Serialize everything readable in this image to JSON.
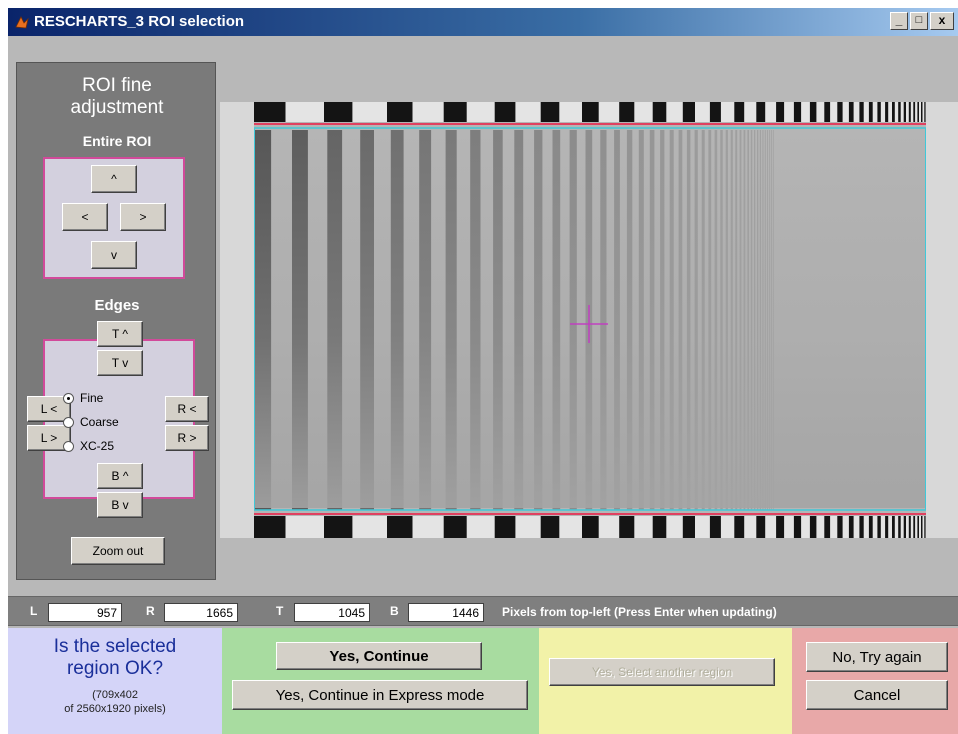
{
  "window": {
    "title": "RESCHARTS_3 ROI selection",
    "controls": [
      "_",
      "□",
      "x"
    ]
  },
  "roi_panel": {
    "title_line1": "ROI fine",
    "title_line2": "adjustment",
    "entire_roi_label": "Entire ROI",
    "move": {
      "up": "^",
      "left": "<",
      "right": ">",
      "down": "v"
    },
    "edges_label": "Edges",
    "edges": {
      "t_up": "T ^",
      "t_down": "T v",
      "l_left": "L <",
      "l_right": "L >",
      "r_left": "R <",
      "r_right": "R >",
      "b_up": "B ^",
      "b_down": "B v"
    },
    "step_options": [
      "Fine",
      "Coarse",
      "XC-25"
    ],
    "step_selected": "Fine",
    "zoom_out": "Zoom out"
  },
  "coords": {
    "L_label": "L",
    "L_value": "957",
    "R_label": "R",
    "R_value": "1665",
    "T_label": "T",
    "T_value": "1045",
    "B_label": "B",
    "B_value": "1446",
    "hint": "Pixels from top-left  (Press Enter when updating)"
  },
  "question": {
    "line1": "Is the selected",
    "line2": "region OK?",
    "size_line1": "(709x402",
    "size_line2": "of 2560x1920 pixels)"
  },
  "actions": {
    "yes_continue": "Yes, Continue",
    "yes_express": "Yes, Continue in Express mode",
    "yes_another": "Yes, Select another region",
    "no_try_again": "No, Try again",
    "cancel": "Cancel"
  },
  "colors": {
    "panel_pink": "#d14a9a",
    "roi_cyan": "#40c8d8",
    "roi_red": "#e04060",
    "crosshair": "#c040c0"
  }
}
